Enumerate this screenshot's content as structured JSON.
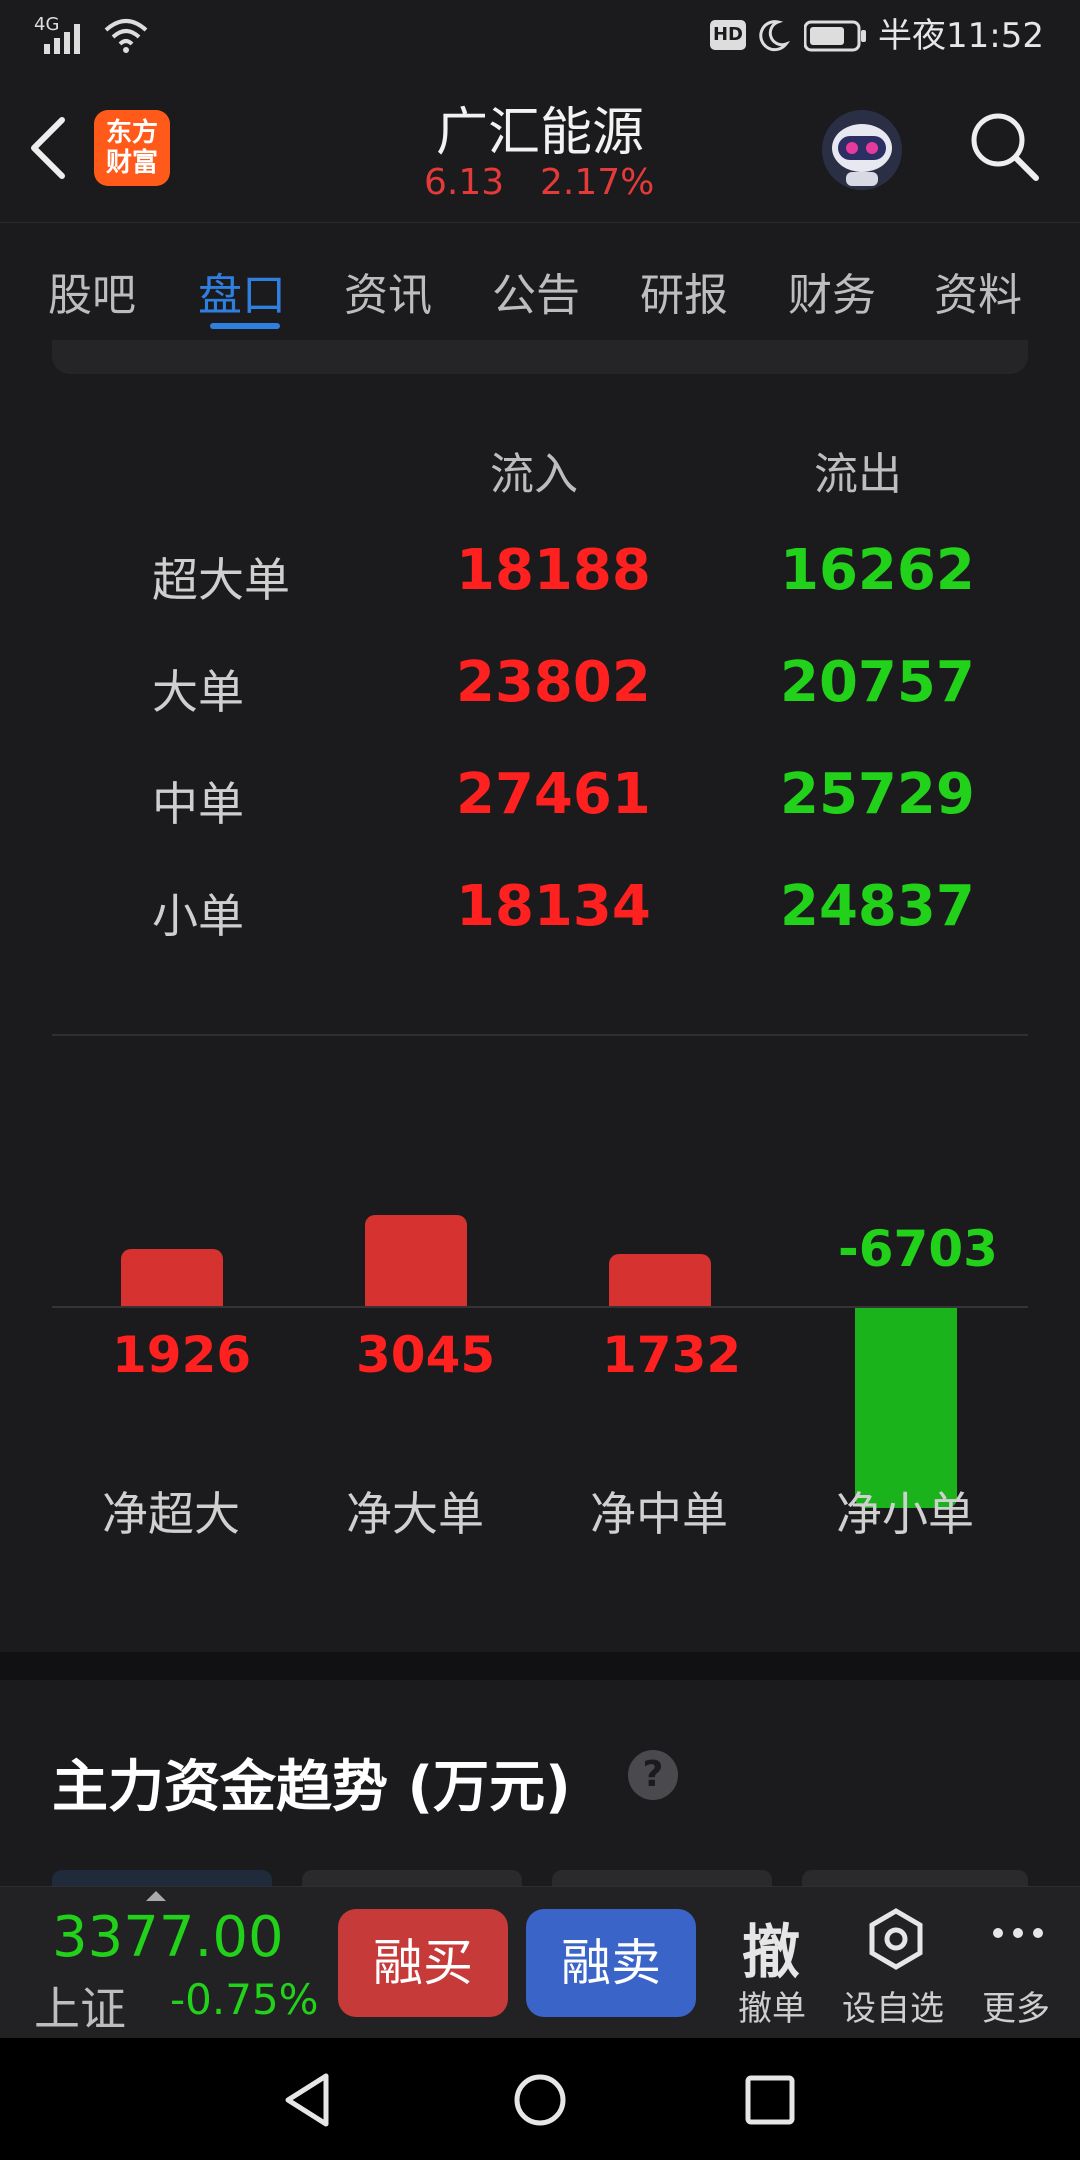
{
  "status_bar": {
    "signal_text": "4G",
    "time": "半夜11:52",
    "icons": [
      "signal-icon",
      "wifi-icon",
      "hd-icon",
      "moon-icon",
      "battery-icon"
    ]
  },
  "header": {
    "app_logo_line1": "东方",
    "app_logo_line2": "财富",
    "stock_name": "广汇能源",
    "price": "6.13",
    "change_pct": "2.17%"
  },
  "tabs": [
    {
      "label": "股吧"
    },
    {
      "label": "盘口"
    },
    {
      "label": "资讯"
    },
    {
      "label": "公告"
    },
    {
      "label": "研报"
    },
    {
      "label": "财务"
    },
    {
      "label": "资料"
    }
  ],
  "flow_table": {
    "col_in": "流入",
    "col_out": "流出",
    "rows": [
      {
        "label": "超大单",
        "in": "18188",
        "out": "16262"
      },
      {
        "label": "大单",
        "in": "23802",
        "out": "20757"
      },
      {
        "label": "中单",
        "in": "27461",
        "out": "25729"
      },
      {
        "label": "小单",
        "in": "18134",
        "out": "24837"
      }
    ]
  },
  "net_chart": {
    "items": [
      {
        "label": "净超大",
        "value": 1926,
        "text": "1926"
      },
      {
        "label": "净大单",
        "value": 3045,
        "text": "3045"
      },
      {
        "label": "净中单",
        "value": 1732,
        "text": "1732"
      },
      {
        "label": "净小单",
        "value": -6703,
        "text": "-6703"
      }
    ]
  },
  "section": {
    "title": "主力资金趋势 (万元)",
    "help": "?"
  },
  "bottom_bar": {
    "index_value": "3377.00",
    "index_name": "上证",
    "index_change": "-0.75%",
    "buy_label": "融买",
    "sell_label": "融卖",
    "cancel_icon_text": "撤",
    "cancel_label": "撤单",
    "watch_label": "设自选",
    "more_label": "更多"
  },
  "colors": {
    "up": "#ff2020",
    "down": "#22d11a",
    "accent": "#2f7fe0"
  }
}
